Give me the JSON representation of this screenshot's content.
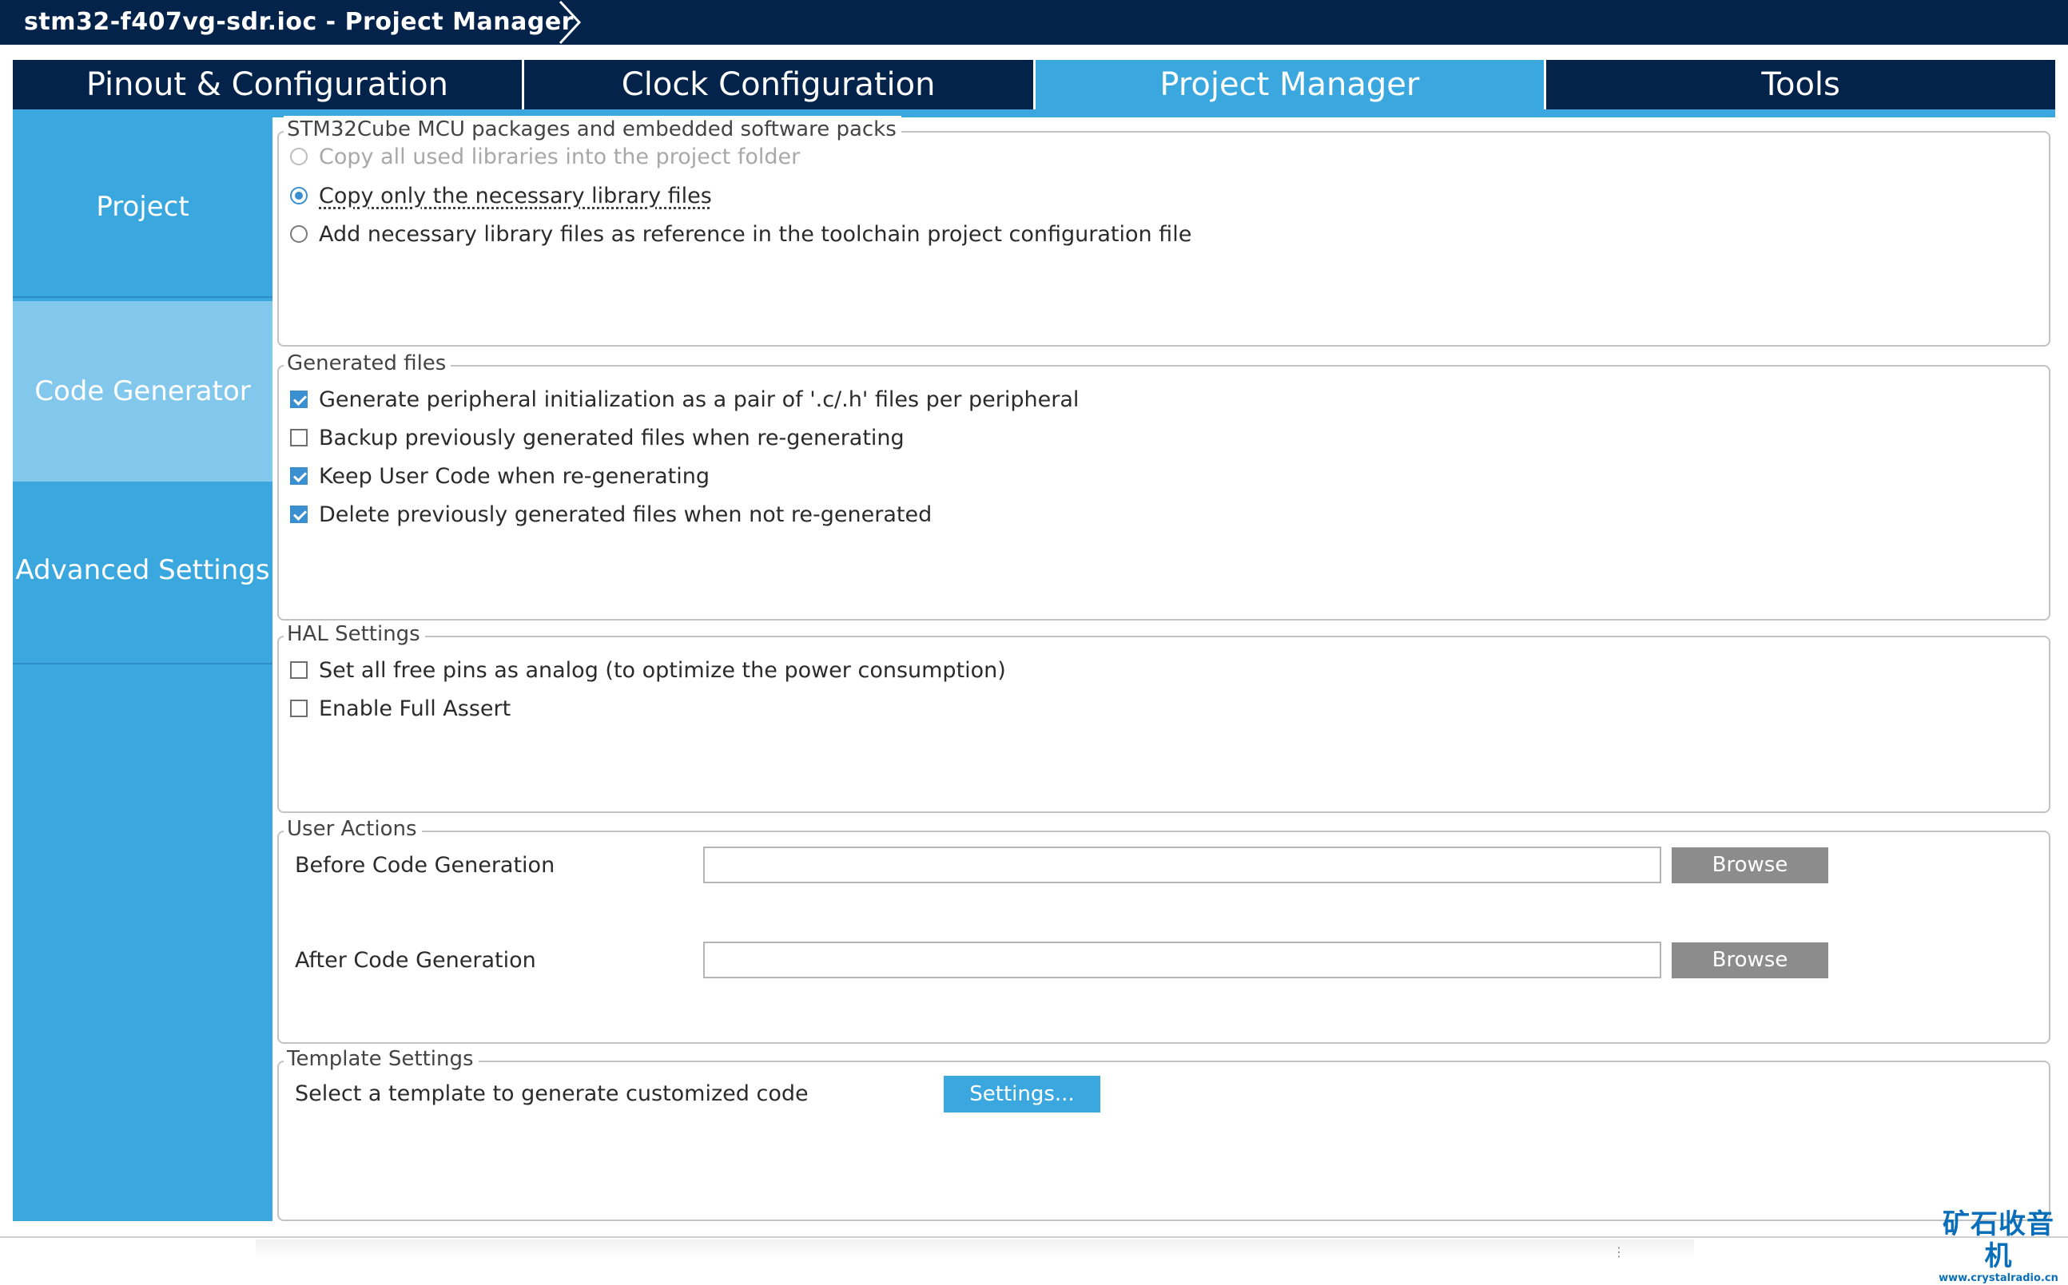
{
  "window": {
    "title": "stm32-f407vg-sdr.ioc - Project Manager"
  },
  "tabs": [
    {
      "label": "Pinout & Configuration",
      "active": false
    },
    {
      "label": "Clock Configuration",
      "active": false
    },
    {
      "label": "Project Manager",
      "active": true
    },
    {
      "label": "Tools",
      "active": false
    }
  ],
  "sidebar": {
    "items": [
      {
        "label": "Project",
        "selected": false
      },
      {
        "label": "Code Generator",
        "selected": true
      },
      {
        "label": "Advanced Settings",
        "selected": false
      }
    ]
  },
  "packs": {
    "legend": "STM32Cube MCU packages and embedded software packs",
    "options": [
      {
        "label": "Copy all used libraries into the project folder",
        "selected": false,
        "enabled": false
      },
      {
        "label": "Copy only the necessary library files",
        "selected": true,
        "enabled": true
      },
      {
        "label": "Add necessary library files as reference in the toolchain project configuration file",
        "selected": false,
        "enabled": true
      }
    ]
  },
  "generated_files": {
    "legend": "Generated files",
    "options": [
      {
        "label": "Generate peripheral initialization as a pair of '.c/.h' files per peripheral",
        "checked": true
      },
      {
        "label": "Backup previously generated files when re-generating",
        "checked": false
      },
      {
        "label": "Keep User Code when re-generating",
        "checked": true
      },
      {
        "label": "Delete previously generated files when not re-generated",
        "checked": true
      }
    ]
  },
  "hal_settings": {
    "legend": "HAL Settings",
    "options": [
      {
        "label": "Set all free pins as analog (to optimize the power consumption)",
        "checked": false
      },
      {
        "label": "Enable Full Assert",
        "checked": false
      }
    ]
  },
  "user_actions": {
    "legend": "User Actions",
    "before_label": "Before Code Generation",
    "before_value": "",
    "after_label": "After Code Generation",
    "after_value": "",
    "browse_label": "Browse"
  },
  "template_settings": {
    "legend": "Template Settings",
    "label": "Select a template to generate customized code",
    "button_label": "Settings..."
  },
  "watermark": {
    "name": "矿石收音机",
    "url": "www.crystalradio.cn"
  },
  "colors": {
    "titlebar": "#03234b",
    "accent": "#3aa8df",
    "sidebar_selected": "#82c8ec",
    "check": "#3a8fd1",
    "browse_button": "#8c8c8c"
  }
}
